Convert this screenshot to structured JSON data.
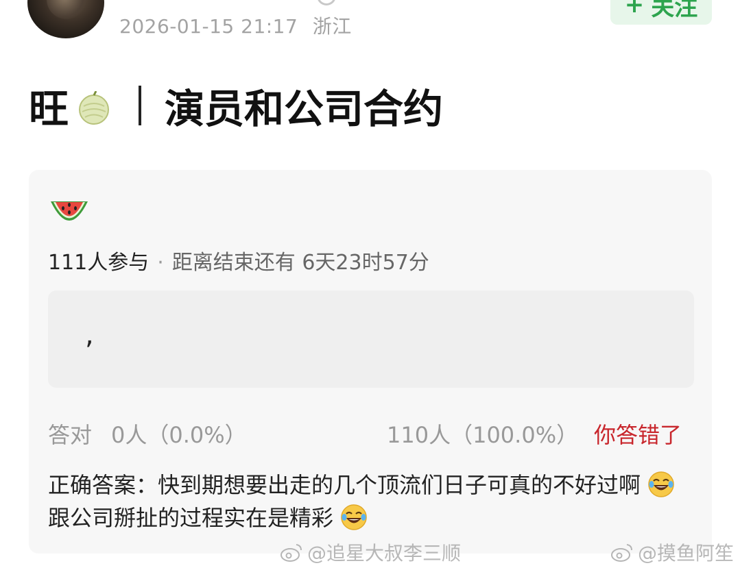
{
  "post": {
    "timestamp": "2026-01-15 21:17",
    "location": "浙江",
    "follow_label": "关注",
    "follow_prefix": "+"
  },
  "title": {
    "prefix": "旺",
    "text": "演员和公司合约"
  },
  "quiz": {
    "participants": "111人参与",
    "separator": "·",
    "remaining": "距离结束还有 6天23时57分",
    "answer_option": ",",
    "correct_label": "答对",
    "correct_value": "0人（0.0%）",
    "wrong_value": "110人（100.0%）",
    "wrong_label": "你答错了",
    "explanation_part1": "正确答案：快到期想要出走的几个顶流们日子可真的不好过啊",
    "explanation_part2": "跟公司掰扯的过程实在是精彩"
  },
  "watermarks": {
    "left": "@追星大叔李三顺",
    "right": "@摸鱼阿笙"
  },
  "colors": {
    "follow_text": "#2da44e",
    "follow_bg": "#e7f6ea",
    "wrong_text": "#c8262c",
    "card_bg": "#f7f7f7"
  }
}
